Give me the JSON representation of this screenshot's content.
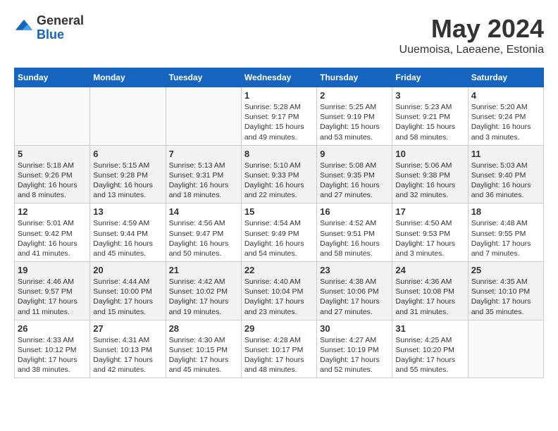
{
  "header": {
    "logo_general": "General",
    "logo_blue": "Blue",
    "month_year": "May 2024",
    "location": "Uuemoisa, Laeaene, Estonia"
  },
  "days_of_week": [
    "Sunday",
    "Monday",
    "Tuesday",
    "Wednesday",
    "Thursday",
    "Friday",
    "Saturday"
  ],
  "weeks": [
    [
      {
        "day": "",
        "info": ""
      },
      {
        "day": "",
        "info": ""
      },
      {
        "day": "",
        "info": ""
      },
      {
        "day": "1",
        "info": "Sunrise: 5:28 AM\nSunset: 9:17 PM\nDaylight: 15 hours\nand 49 minutes."
      },
      {
        "day": "2",
        "info": "Sunrise: 5:25 AM\nSunset: 9:19 PM\nDaylight: 15 hours\nand 53 minutes."
      },
      {
        "day": "3",
        "info": "Sunrise: 5:23 AM\nSunset: 9:21 PM\nDaylight: 15 hours\nand 58 minutes."
      },
      {
        "day": "4",
        "info": "Sunrise: 5:20 AM\nSunset: 9:24 PM\nDaylight: 16 hours\nand 3 minutes."
      }
    ],
    [
      {
        "day": "5",
        "info": "Sunrise: 5:18 AM\nSunset: 9:26 PM\nDaylight: 16 hours\nand 8 minutes."
      },
      {
        "day": "6",
        "info": "Sunrise: 5:15 AM\nSunset: 9:28 PM\nDaylight: 16 hours\nand 13 minutes."
      },
      {
        "day": "7",
        "info": "Sunrise: 5:13 AM\nSunset: 9:31 PM\nDaylight: 16 hours\nand 18 minutes."
      },
      {
        "day": "8",
        "info": "Sunrise: 5:10 AM\nSunset: 9:33 PM\nDaylight: 16 hours\nand 22 minutes."
      },
      {
        "day": "9",
        "info": "Sunrise: 5:08 AM\nSunset: 9:35 PM\nDaylight: 16 hours\nand 27 minutes."
      },
      {
        "day": "10",
        "info": "Sunrise: 5:06 AM\nSunset: 9:38 PM\nDaylight: 16 hours\nand 32 minutes."
      },
      {
        "day": "11",
        "info": "Sunrise: 5:03 AM\nSunset: 9:40 PM\nDaylight: 16 hours\nand 36 minutes."
      }
    ],
    [
      {
        "day": "12",
        "info": "Sunrise: 5:01 AM\nSunset: 9:42 PM\nDaylight: 16 hours\nand 41 minutes."
      },
      {
        "day": "13",
        "info": "Sunrise: 4:59 AM\nSunset: 9:44 PM\nDaylight: 16 hours\nand 45 minutes."
      },
      {
        "day": "14",
        "info": "Sunrise: 4:56 AM\nSunset: 9:47 PM\nDaylight: 16 hours\nand 50 minutes."
      },
      {
        "day": "15",
        "info": "Sunrise: 4:54 AM\nSunset: 9:49 PM\nDaylight: 16 hours\nand 54 minutes."
      },
      {
        "day": "16",
        "info": "Sunrise: 4:52 AM\nSunset: 9:51 PM\nDaylight: 16 hours\nand 58 minutes."
      },
      {
        "day": "17",
        "info": "Sunrise: 4:50 AM\nSunset: 9:53 PM\nDaylight: 17 hours\nand 3 minutes."
      },
      {
        "day": "18",
        "info": "Sunrise: 4:48 AM\nSunset: 9:55 PM\nDaylight: 17 hours\nand 7 minutes."
      }
    ],
    [
      {
        "day": "19",
        "info": "Sunrise: 4:46 AM\nSunset: 9:57 PM\nDaylight: 17 hours\nand 11 minutes."
      },
      {
        "day": "20",
        "info": "Sunrise: 4:44 AM\nSunset: 10:00 PM\nDaylight: 17 hours\nand 15 minutes."
      },
      {
        "day": "21",
        "info": "Sunrise: 4:42 AM\nSunset: 10:02 PM\nDaylight: 17 hours\nand 19 minutes."
      },
      {
        "day": "22",
        "info": "Sunrise: 4:40 AM\nSunset: 10:04 PM\nDaylight: 17 hours\nand 23 minutes."
      },
      {
        "day": "23",
        "info": "Sunrise: 4:38 AM\nSunset: 10:06 PM\nDaylight: 17 hours\nand 27 minutes."
      },
      {
        "day": "24",
        "info": "Sunrise: 4:36 AM\nSunset: 10:08 PM\nDaylight: 17 hours\nand 31 minutes."
      },
      {
        "day": "25",
        "info": "Sunrise: 4:35 AM\nSunset: 10:10 PM\nDaylight: 17 hours\nand 35 minutes."
      }
    ],
    [
      {
        "day": "26",
        "info": "Sunrise: 4:33 AM\nSunset: 10:12 PM\nDaylight: 17 hours\nand 38 minutes."
      },
      {
        "day": "27",
        "info": "Sunrise: 4:31 AM\nSunset: 10:13 PM\nDaylight: 17 hours\nand 42 minutes."
      },
      {
        "day": "28",
        "info": "Sunrise: 4:30 AM\nSunset: 10:15 PM\nDaylight: 17 hours\nand 45 minutes."
      },
      {
        "day": "29",
        "info": "Sunrise: 4:28 AM\nSunset: 10:17 PM\nDaylight: 17 hours\nand 48 minutes."
      },
      {
        "day": "30",
        "info": "Sunrise: 4:27 AM\nSunset: 10:19 PM\nDaylight: 17 hours\nand 52 minutes."
      },
      {
        "day": "31",
        "info": "Sunrise: 4:25 AM\nSunset: 10:20 PM\nDaylight: 17 hours\nand 55 minutes."
      },
      {
        "day": "",
        "info": ""
      }
    ]
  ]
}
